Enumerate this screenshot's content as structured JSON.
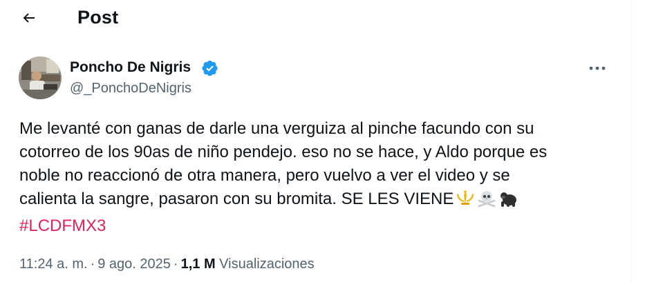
{
  "header": {
    "back_icon": "arrow-left-icon",
    "title": "Post"
  },
  "post": {
    "author_name": "Poncho De Nigris",
    "verified_icon": "verified-badge-icon",
    "handle": "@_PonchoDeNigris",
    "more_icon": "more-horizontal-icon",
    "lines": [
      "Me levanté con ganas de darle una verguiza al pinche facundo con su",
      "cotorreo de los 90as de niño pendejo. eso no se hace,  y Aldo porque es",
      "noble no reaccionó de otra manera, pero vuelvo a ver el video y se",
      "calienta la sangre, pasaron con su bromita. SE LES VIENE"
    ],
    "emojis": [
      "trident-emblem-icon",
      "skull-crossbones-icon",
      "gorilla-icon"
    ],
    "hashtag": "#LCDFMX3",
    "time": "11:24 a. m.",
    "date": "9 ago. 2025",
    "views_count": "1,1 M",
    "views_label": "Visualizaciones",
    "separator": "·"
  },
  "colors": {
    "text": "#0f1419",
    "secondary": "#536471",
    "verified": "#1d9bf0",
    "hashtag": "#e0245e"
  }
}
